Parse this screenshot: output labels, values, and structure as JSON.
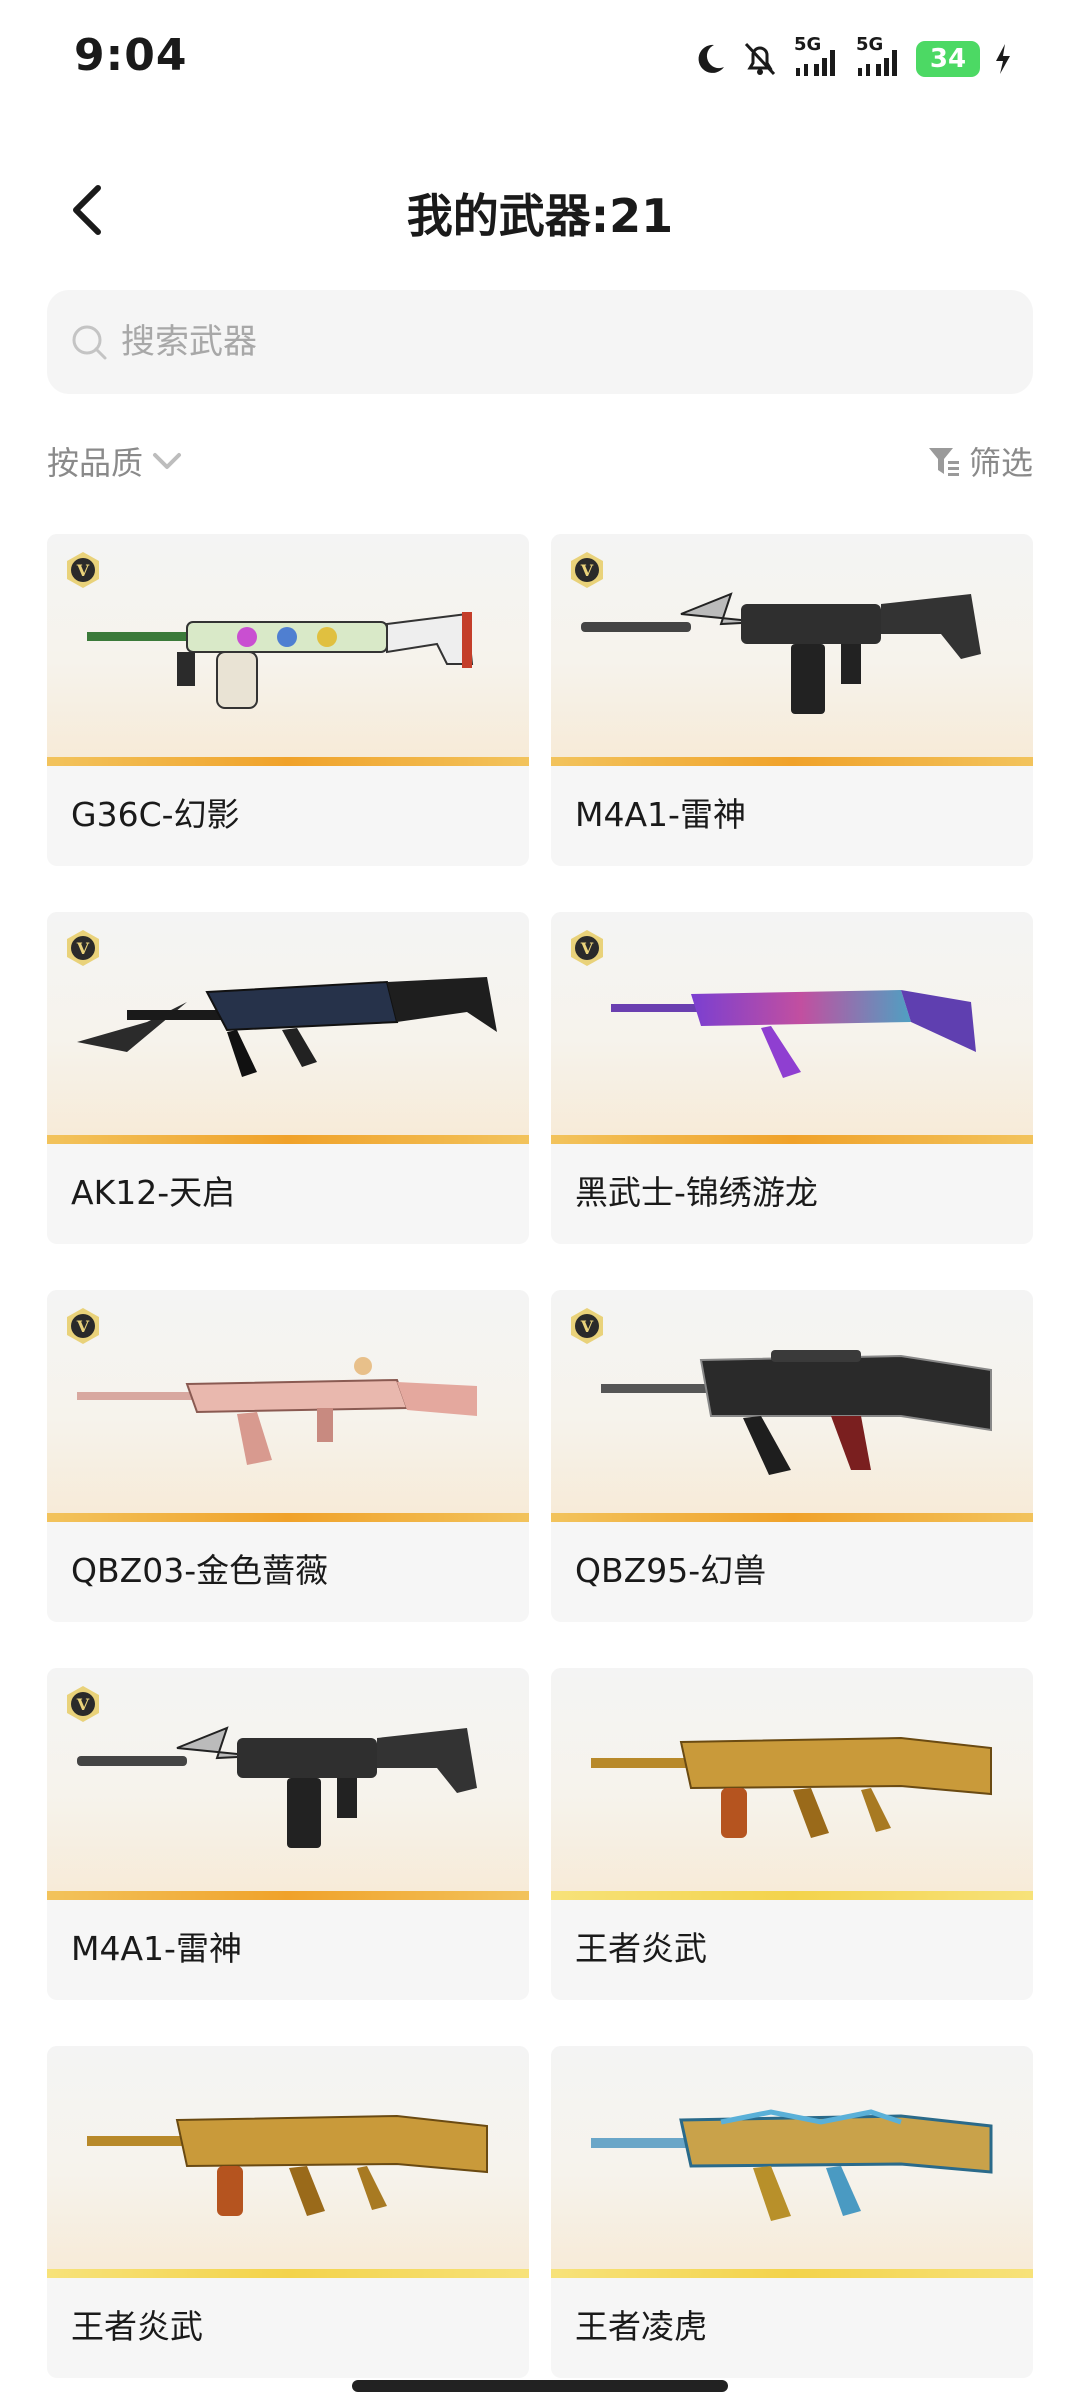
{
  "status_bar": {
    "time": "9:04",
    "network_1": "5G",
    "network_2": "5G",
    "battery": "34",
    "icons": [
      "moon-icon",
      "bell-off-icon",
      "signal-icon",
      "signal-icon",
      "battery-icon",
      "charging-icon"
    ]
  },
  "header": {
    "back_icon": "chevron-left-icon",
    "title": "我的武器:21"
  },
  "search": {
    "placeholder": "搜索武器",
    "value": "",
    "icon": "search-icon"
  },
  "filters": {
    "sort_label": "按品质",
    "filter_label": "筛选",
    "sort_icon": "chevron-down-icon",
    "filter_icon": "filter-icon"
  },
  "colors": {
    "accent_stripe": "#f0a22a",
    "gold_stripe": "#f3d34b",
    "text_primary": "#1a1a1a",
    "text_secondary": "#8a8a8a",
    "card_bg": "#f6f6f6"
  },
  "weapons": [
    {
      "name": "G36C-幻影",
      "has_v_badge": true
    },
    {
      "name": "M4A1-雷神",
      "has_v_badge": true
    },
    {
      "name": "AK12-天启",
      "has_v_badge": true
    },
    {
      "name": "黑武士-锦绣游龙",
      "has_v_badge": true
    },
    {
      "name": "QBZ03-金色蔷薇",
      "has_v_badge": true
    },
    {
      "name": "QBZ95-幻兽",
      "has_v_badge": true
    },
    {
      "name": "M4A1-雷神",
      "has_v_badge": true
    },
    {
      "name": "王者炎武",
      "has_v_badge": false
    },
    {
      "name": "王者炎武",
      "has_v_badge": false
    },
    {
      "name": "王者凌虎",
      "has_v_badge": false
    }
  ]
}
